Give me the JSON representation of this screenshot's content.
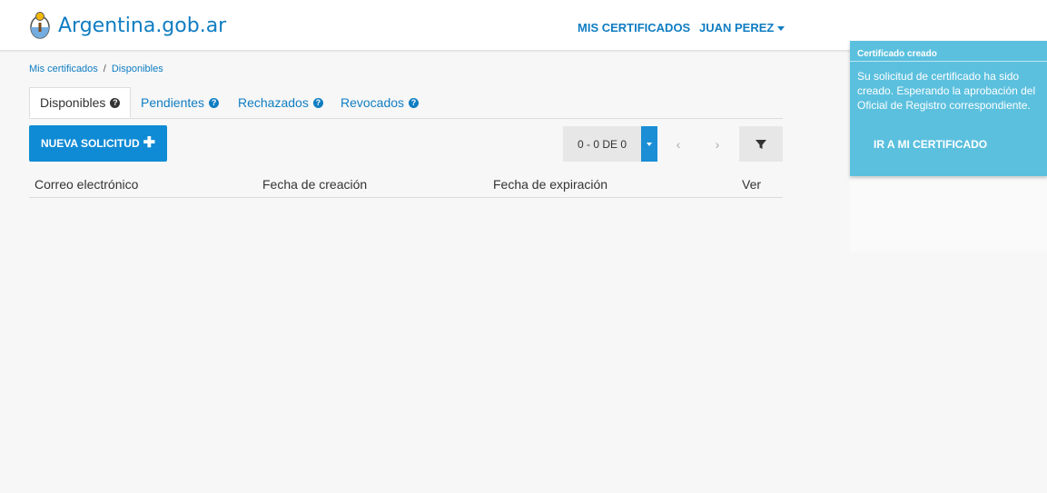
{
  "header": {
    "logo_text": "Argentina.gob.ar",
    "nav_certificates": "MIS CERTIFICADOS",
    "user_name": "JUAN PEREZ"
  },
  "breadcrumb": [
    "Mis certificados",
    "Disponibles"
  ],
  "tabs": [
    {
      "label": "Disponibles",
      "active": true
    },
    {
      "label": "Pendientes",
      "active": false
    },
    {
      "label": "Rechazados",
      "active": false
    },
    {
      "label": "Revocados",
      "active": false
    }
  ],
  "toolbar": {
    "new_request_label": "NUEVA SOLICITUD",
    "pager_text": "0 - 0 DE 0",
    "prev_symbol": "‹",
    "next_symbol": "›"
  },
  "table": {
    "columns": [
      "Correo electrónico",
      "Fecha de creación",
      "Fecha de expiración",
      "Ver"
    ],
    "rows": []
  },
  "notification": {
    "title": "Certificado creado",
    "body": "Su solicitud de certificado ha sido creado. Esperando la aprobación del Oficial de Registro correspondiente.",
    "action_label": "IR A MI CERTIFICADO"
  },
  "colors": {
    "primary": "#0f7dc2",
    "button": "#0f8bd5",
    "notification": "#5bc0de",
    "background": "#f7f7f7"
  }
}
